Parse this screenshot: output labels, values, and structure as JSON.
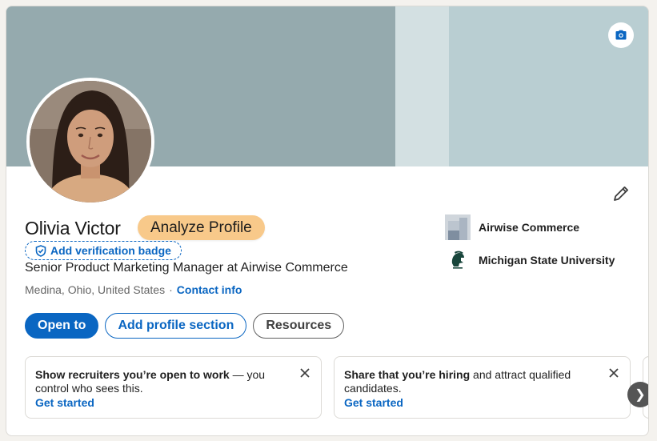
{
  "profile": {
    "name": "Olivia Victor",
    "analyze_label": "Analyze Profile",
    "verify_label": "Add verification badge",
    "headline": "Senior Product Marketing Manager at Airwise Commerce",
    "location": "Medina, Ohio, United States",
    "separator": "·",
    "contact_label": "Contact info"
  },
  "actions": {
    "open_to": "Open to",
    "add_section": "Add profile section",
    "resources": "Resources"
  },
  "organizations": [
    {
      "name": "Airwise Commerce"
    },
    {
      "name": "Michigan State University"
    }
  ],
  "recommendations": [
    {
      "bold": "Show recruiters you’re open to work",
      "rest": " — you control who sees this.",
      "cta": "Get started"
    },
    {
      "bold": "Share that you’re hiring",
      "rest": " and attract qualified candidates.",
      "cta": "Get started"
    }
  ],
  "icons": {
    "camera": "camera-icon",
    "edit": "pencil-icon",
    "verify": "shield-check-icon",
    "close": "close-icon",
    "next": "chevron-right-icon"
  },
  "next_glyph": "❯",
  "colors": {
    "accent": "#0a66c2",
    "analyze_bg": "#f8c98a",
    "banner_bg": "#b8cdd1",
    "banner_arc": "#95aaae"
  }
}
